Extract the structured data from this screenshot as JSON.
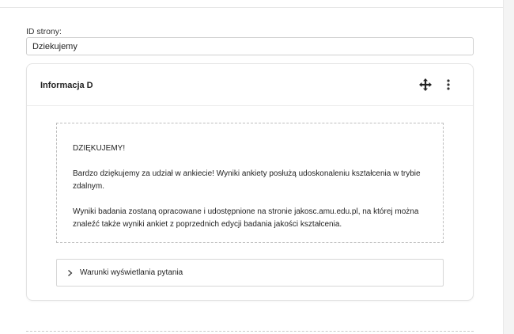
{
  "page_id": {
    "label": "ID strony:",
    "value": "Dziekujemy"
  },
  "card": {
    "title": "Informacja D",
    "icons": {
      "move": "move-arrows-icon",
      "more": "more-vertical-icon"
    },
    "content": {
      "heading": "DZIĘKUJEMY!",
      "paragraph1": "Bardzo dziękujemy za udział w ankiecie! Wyniki ankiety posłużą udoskonaleniu kształcenia w trybie zdalnym.",
      "paragraph2": "Wyniki badania zostaną opracowane i udostępnione na stronie jakosc.amu.edu.pl, na której można znaleźć także wyniki ankiet z poprzednich edycji badania jakości kształcenia."
    },
    "conditions": {
      "label": "Warunki wyświetlania pytania",
      "icon": "chevron-right-icon"
    }
  }
}
